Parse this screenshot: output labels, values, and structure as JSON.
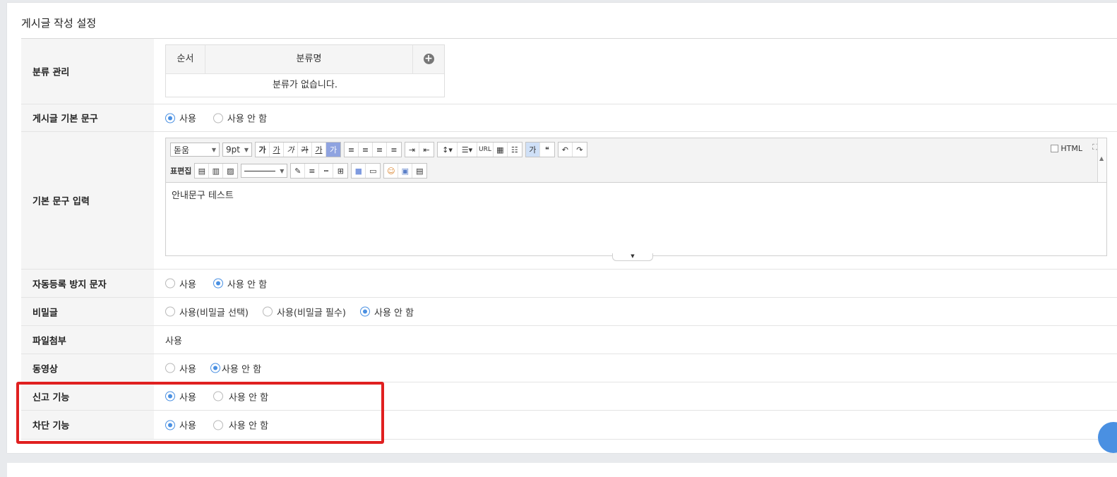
{
  "panel": {
    "title": "게시글 작성 설정"
  },
  "category": {
    "label": "분류 관리",
    "col_order": "순서",
    "col_name": "분류명",
    "empty": "분류가 없습니다."
  },
  "default_text": {
    "label": "게시글 기본 문구",
    "options": [
      "사용",
      "사용 안 함"
    ],
    "selected": 0
  },
  "default_text_input": {
    "label": "기본 문구 입력",
    "editor": {
      "font": "돋움",
      "size": "9pt",
      "row1_group1": [
        "가",
        "가",
        "가",
        "가",
        "가"
      ],
      "url_label": "URL",
      "table_edit_label": "표편집",
      "html_label": "HTML",
      "content": "안내문구 테스트"
    }
  },
  "captcha": {
    "label": "자동등록 방지 문자",
    "options": [
      "사용",
      "사용 안 함"
    ],
    "selected": 1
  },
  "secret": {
    "label": "비밀글",
    "options": [
      "사용(비밀글 선택)",
      "사용(비밀글 필수)",
      "사용 안 함"
    ],
    "selected": 2
  },
  "attachment": {
    "label": "파일첨부",
    "value": "사용"
  },
  "video": {
    "label": "동영상",
    "options": [
      "사용",
      "사용 안 함"
    ],
    "selected": 1
  },
  "report": {
    "label": "신고 기능",
    "options": [
      "사용",
      "사용 안 함"
    ],
    "selected": 0
  },
  "block": {
    "label": "차단 기능",
    "options": [
      "사용",
      "사용 안 함"
    ],
    "selected": 0
  },
  "colors": {
    "accent": "#4a90e2",
    "highlight": "#e02020"
  }
}
